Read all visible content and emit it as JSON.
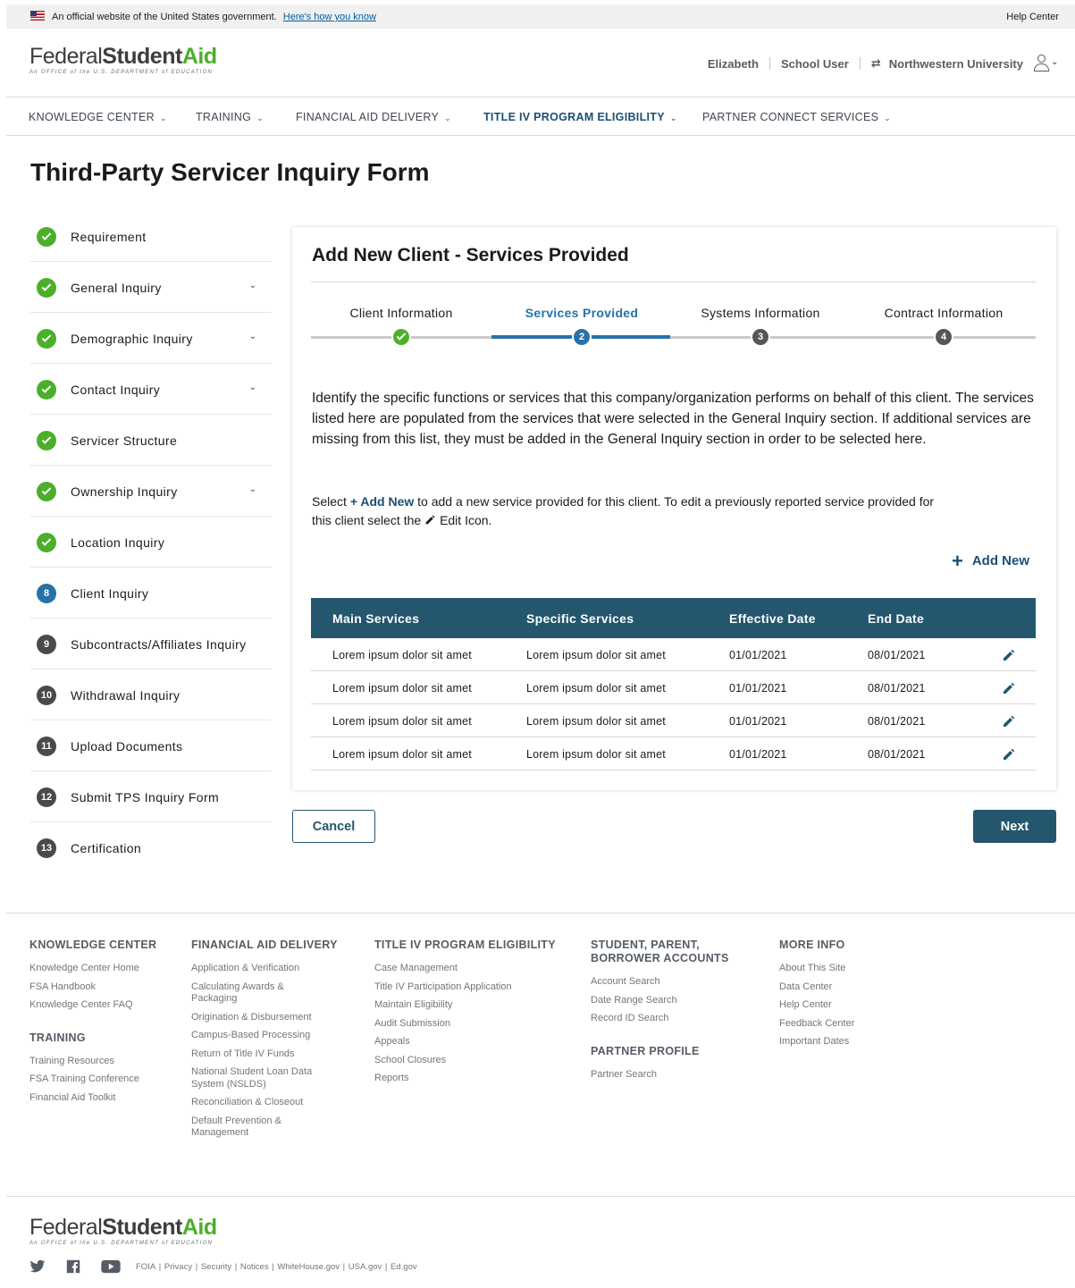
{
  "gov_banner": {
    "text": "An official website of the United States government.",
    "link": "Here's how you know",
    "help": "Help Center"
  },
  "logo": {
    "part1": "Federal",
    "part2": "Student",
    "part3": "Aid",
    "subtitle": "An OFFICE of the U.S. DEPARTMENT of EDUCATION"
  },
  "user": {
    "name": "Elizabeth",
    "role": "School User",
    "org": "Northwestern University"
  },
  "nav": [
    {
      "label": "KNOWLEDGE CENTER"
    },
    {
      "label": "TRAINING"
    },
    {
      "label": "FINANCIAL AID DELIVERY"
    },
    {
      "label": "TITLE IV PROGRAM ELIGIBILITY"
    },
    {
      "label": "PARTNER CONNECT SERVICES"
    }
  ],
  "page_title": "Third-Party Servicer Inquiry Form",
  "steps": [
    {
      "label": "Requirement",
      "status": "done",
      "num": ""
    },
    {
      "label": "General Inquiry",
      "status": "done",
      "num": ""
    },
    {
      "label": "Demographic Inquiry",
      "status": "done",
      "num": ""
    },
    {
      "label": "Contact Inquiry",
      "status": "done",
      "num": ""
    },
    {
      "label": "Servicer Structure",
      "status": "done",
      "num": ""
    },
    {
      "label": "Ownership Inquiry",
      "status": "done",
      "num": ""
    },
    {
      "label": "Location Inquiry",
      "status": "done",
      "num": ""
    },
    {
      "label": "Client Inquiry",
      "status": "current",
      "num": "8"
    },
    {
      "label": "Subcontracts/Affiliates Inquiry",
      "status": "todo",
      "num": "9"
    },
    {
      "label": "Withdrawal Inquiry",
      "status": "todo",
      "num": "10"
    },
    {
      "label": "Upload Documents",
      "status": "todo",
      "num": "11"
    },
    {
      "label": "Submit TPS Inquiry Form",
      "status": "todo",
      "num": "12"
    },
    {
      "label": "Certification",
      "status": "todo",
      "num": "13"
    }
  ],
  "card": {
    "title": "Add New Client - Services Provided",
    "stepper": [
      {
        "label": "Client Information",
        "num": ""
      },
      {
        "label": "Services Provided",
        "num": "2"
      },
      {
        "label": "Systems Information",
        "num": "3"
      },
      {
        "label": "Contract Information",
        "num": "4"
      }
    ],
    "intro": "Identify the specific functions or services that this company/organization performs on behalf of this client.  The services listed here are populated from the services that were selected in the General Inquiry section.  If additional services are missing from this list, they must be added in the General Inquiry section in order to be selected here.",
    "instruct_1": "Select ",
    "instruct_addnew": "+ Add New",
    "instruct_2": " to add a new service provided for this client. To edit a previously reported service provided for this client select the ",
    "instruct_3": "Edit Icon.",
    "add_new": "Add New",
    "table": {
      "headers": [
        "Main Services",
        "Specific Services",
        "Effective Date",
        "End Date"
      ],
      "rows": [
        [
          "Lorem ipsum dolor sit amet",
          "Lorem ipsum dolor sit amet",
          "01/01/2021",
          "08/01/2021"
        ],
        [
          "Lorem ipsum dolor sit amet",
          "Lorem ipsum dolor sit amet",
          "01/01/2021",
          "08/01/2021"
        ],
        [
          "Lorem ipsum dolor sit amet",
          "Lorem ipsum dolor sit amet",
          "01/01/2021",
          "08/01/2021"
        ],
        [
          "Lorem ipsum dolor sit amet",
          "Lorem ipsum dolor sit amet",
          "01/01/2021",
          "08/01/2021"
        ]
      ]
    }
  },
  "buttons": {
    "cancel": "Cancel",
    "next": "Next"
  },
  "footer": {
    "knowledge": {
      "head": "KNOWLEDGE CENTER",
      "links": [
        "Knowledge Center Home",
        "FSA Handbook",
        "Knowledge Center FAQ"
      ]
    },
    "training": {
      "head": "TRAINING",
      "links": [
        "Training Resources",
        "FSA Training Conference",
        "Financial Aid Toolkit"
      ]
    },
    "fad": {
      "head": "FINANCIAL AID DELIVERY",
      "links": [
        "Application & Verification",
        "Calculating Awards & Packaging",
        "Origination & Disbursement",
        "Campus-Based Processing",
        "Return of Title IV Funds",
        "National Student Loan Data System (NSLDS)",
        "Reconciliation & Closeout",
        "Default Prevention & Management"
      ]
    },
    "t4": {
      "head": "TITLE IV PROGRAM ELIGIBILITY",
      "links": [
        "Case Management",
        "Title IV Participation Application",
        "Maintain Eligibility",
        "Audit Submission",
        "Appeals",
        "School Closures",
        "Reports"
      ]
    },
    "accounts": {
      "head": "STUDENT, PARENT, BORROWER ACCOUNTS",
      "links": [
        "Account Search",
        "Date Range Search",
        "Record ID Search"
      ]
    },
    "partner": {
      "head": "PARTNER PROFILE",
      "links": [
        "Partner Search"
      ]
    },
    "more": {
      "head": "MORE INFO",
      "links": [
        "About This Site",
        "Data Center",
        "Help Center",
        "Feedback Center",
        "Important Dates"
      ]
    },
    "legal": [
      "FOIA",
      "Privacy",
      "Security",
      "Notices",
      "WhiteHouse.gov",
      "USA.gov",
      "Ed.gov"
    ]
  },
  "colors": {
    "primary": "#24566e",
    "accent_blue": "#2672a8",
    "success": "#4caf2a"
  }
}
